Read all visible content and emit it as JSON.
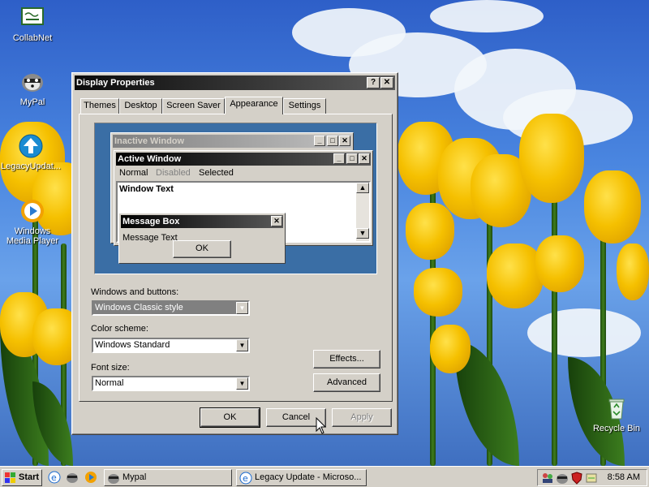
{
  "desktop": {
    "icons": [
      {
        "label": "CollabNet",
        "icon": "certificate-icon"
      },
      {
        "label": "MyPal",
        "icon": "raccoon-icon"
      },
      {
        "label": "LegacyUpdat...",
        "icon": "update-arrow-icon"
      },
      {
        "label": "Windows Media Player",
        "icon": "media-player-icon"
      },
      {
        "label": "Recycle Bin",
        "icon": "recycle-bin-icon"
      }
    ]
  },
  "dialog": {
    "title": "Display Properties",
    "help_glyph": "?",
    "close_glyph": "✕",
    "tabs": [
      "Themes",
      "Desktop",
      "Screen Saver",
      "Appearance",
      "Settings"
    ],
    "active_tab": "Appearance",
    "preview": {
      "inactive_title": "Inactive Window",
      "active_title": "Active Window",
      "menu": [
        "Normal",
        "Disabled",
        "Selected"
      ],
      "window_text": "Window Text",
      "message_title": "Message Box",
      "message_text": "Message Text",
      "ok": "OK"
    },
    "windows_buttons_label": "Windows and buttons:",
    "windows_buttons_value": "Windows Classic style",
    "color_scheme_label": "Color scheme:",
    "color_scheme_value": "Windows Standard",
    "font_size_label": "Font size:",
    "font_size_value": "Normal",
    "effects_button": "Effects...",
    "advanced_button": "Advanced",
    "ok_button": "OK",
    "cancel_button": "Cancel",
    "apply_button": "Apply"
  },
  "taskbar": {
    "start": "Start",
    "tasks": [
      {
        "label": "Mypal",
        "icon": "raccoon-icon"
      },
      {
        "label": "Legacy Update - Microso...",
        "icon": "ie-icon"
      }
    ],
    "clock": "8:58 AM"
  },
  "colors": {
    "face": "#d4d0c8",
    "active_title": "#000000",
    "inactive_title": "#808080",
    "preview_bg": "#3a6ea5"
  }
}
